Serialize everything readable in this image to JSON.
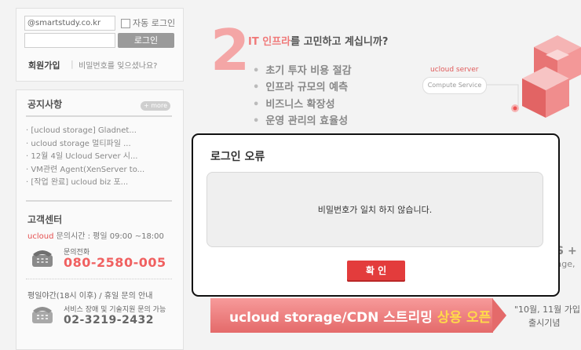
{
  "login": {
    "email_value": "@smartstudy.co.kr",
    "password_value": "",
    "auto_login_label": "자동 로그인",
    "login_button": "로그인",
    "signup_link": "회원가입",
    "separator": "|",
    "find_password_link": "비밀번호를 잊으셨나요?"
  },
  "notice": {
    "title": "공지사항",
    "more_label": "+ more",
    "items": [
      "· [ucloud storage] Gladnet...",
      "· ucloud storage 멀티파일 ...",
      "· 12월 4일 Ucloud Server 시...",
      "· VM관련 Agent(XenServer to...",
      "· [작업 완료] ucloud biz 포..."
    ]
  },
  "customer_center": {
    "title": "고객센터",
    "brand": "ucloud",
    "hours": " 문의시간 : 평일 09:00 ~18:00",
    "phone_label": "문의전화",
    "phone_number": "080-2580-005",
    "night_title": "평일야간(18시 이후) / 휴일 문의 안내",
    "night_label": "서비스 장애 및 기술지원 문의 가능",
    "night_number": "02-3219-2432"
  },
  "banner": {
    "number": "2",
    "heading_accent": "IT 인프라",
    "heading_rest": "를 고민하고 계십니까?",
    "bullets": [
      "초기 투자 비용 절감",
      "인프라 규모의 예측",
      "비즈니스 확장성",
      "운영 관리의 효율성"
    ],
    "server_label": "ucloud server",
    "compute_label": "Compute Service",
    "side_title": "S +",
    "side_sub": "rage,",
    "strip_prefix": "ucloud storage/CDN 스트리밍 ",
    "strip_highlight": "상용 오픈",
    "right_line1": "\"10월, 11월 가입",
    "right_line2": "출시기념"
  },
  "modal": {
    "title": "로그인 오류",
    "message": "비밀번호가 일치 하지 않습니다.",
    "confirm_button": "확 인"
  },
  "colors": {
    "accent_red": "#e33c3c",
    "banner_pink": "#f4a6a6",
    "cube_red": "#e46a6a"
  }
}
